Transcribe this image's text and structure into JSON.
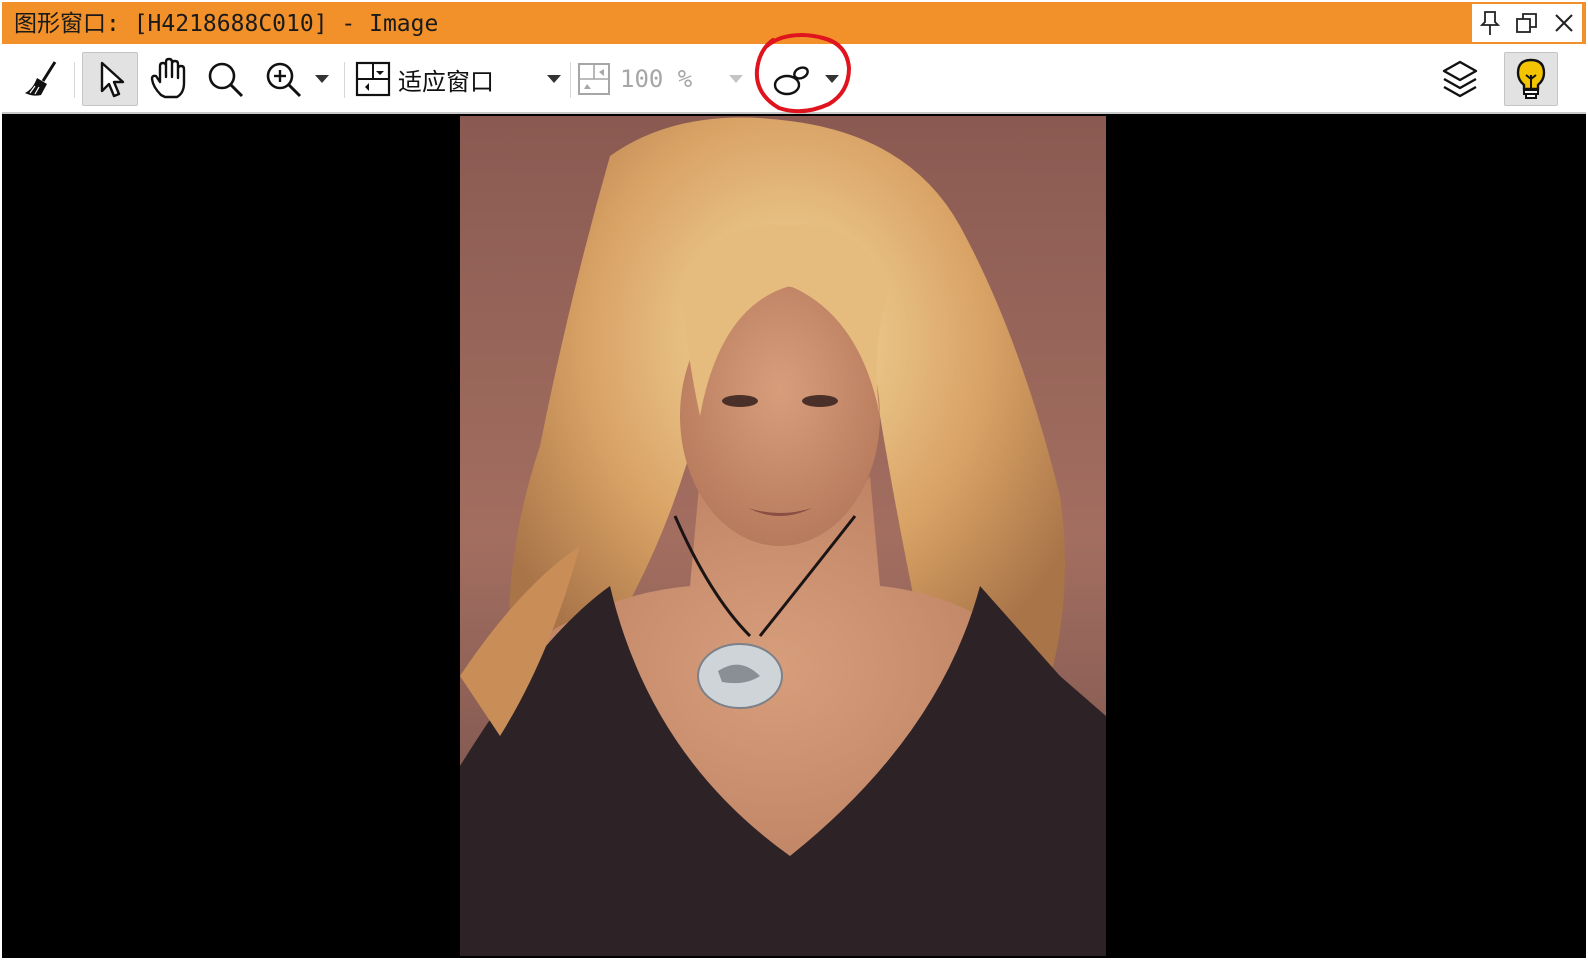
{
  "window": {
    "title": "图形窗口: [H4218688C010] - Image",
    "accent_color": "#f29129",
    "controls": [
      {
        "icon": "pin-icon"
      },
      {
        "icon": "restore-icon"
      },
      {
        "icon": "close-icon"
      }
    ]
  },
  "toolbar": {
    "fit_label": "适应窗口",
    "zoom_value": "100 %",
    "tools": [
      "broom-icon",
      "pointer-icon",
      "hand-icon",
      "search-icon",
      "zoom-in-icon",
      "fit-window-icon",
      "actual-size-icon",
      "shapes-icon",
      "layers-icon",
      "lightbulb-icon"
    ],
    "annotation_color": "#e0141e"
  },
  "canvas": {
    "background": "#000000",
    "image": "portrait photo of a woman with long blonde hair wearing a dark top and a pendant necklace"
  }
}
